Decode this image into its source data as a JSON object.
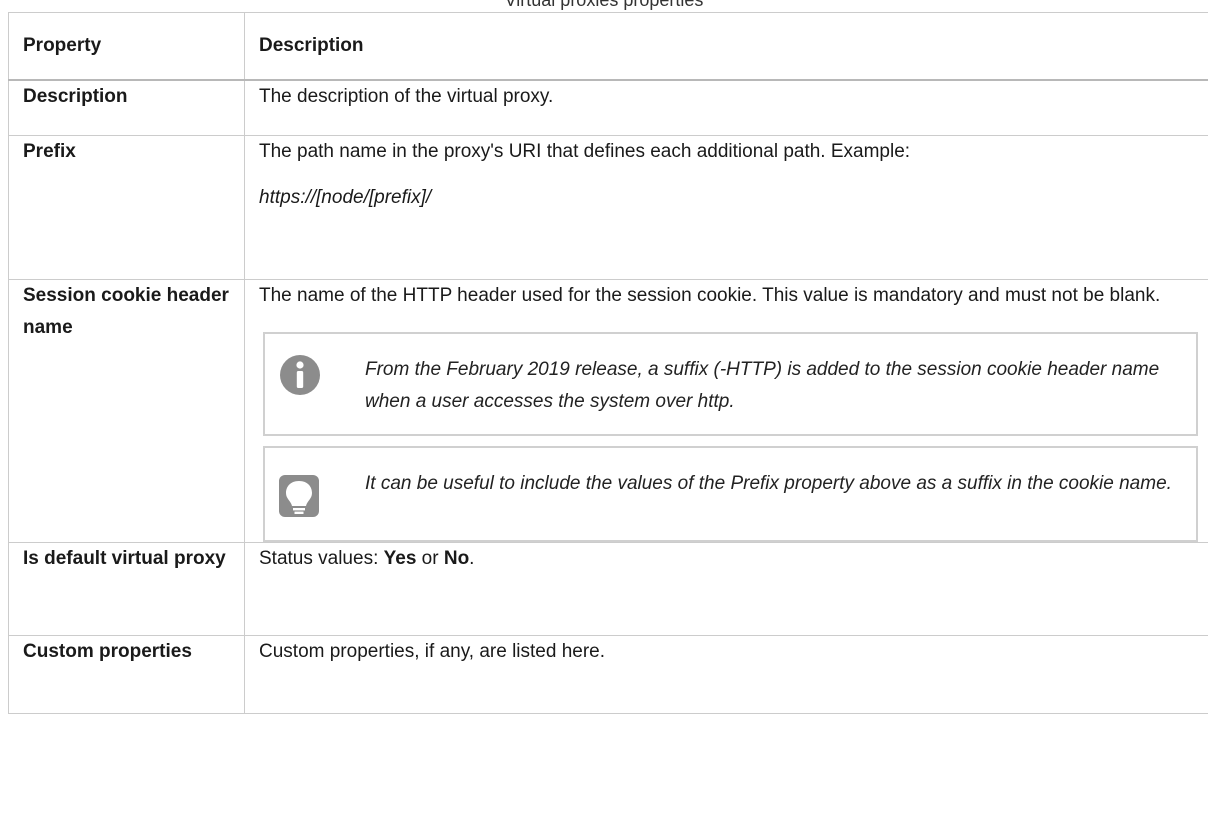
{
  "caption": "Virtual proxies properties",
  "table": {
    "headers": [
      "Property",
      "Description"
    ],
    "rows": {
      "description": {
        "property": "Description",
        "text": "The description of the virtual proxy."
      },
      "prefix": {
        "property": "Prefix",
        "text": "The path name in the proxy's URI that defines each additional path. Example:",
        "example": "https://[node/[prefix]/"
      },
      "session": {
        "property": "Session cookie header name",
        "text": "The name of the HTTP header used for the session cookie. This value is mandatory and must not be blank.",
        "note_info": "From the February 2019 release, a suffix (-HTTP) is added to the session cookie header name when a user accesses the system over http.",
        "note_tip": "It can be useful to include the values of the Prefix property above as a suffix in the cookie name."
      },
      "default": {
        "property": "Is default virtual proxy",
        "prefix_text": "Status values: ",
        "yes": "Yes",
        "or": " or ",
        "no": "No",
        "period": "."
      },
      "custom": {
        "property": "Custom properties",
        "text": "Custom properties, if any, are listed here."
      }
    }
  },
  "icons": {
    "info": "info-icon",
    "tip": "lightbulb-icon"
  },
  "colors": {
    "border": "#cccccc",
    "icon": "#8c8c8c"
  }
}
